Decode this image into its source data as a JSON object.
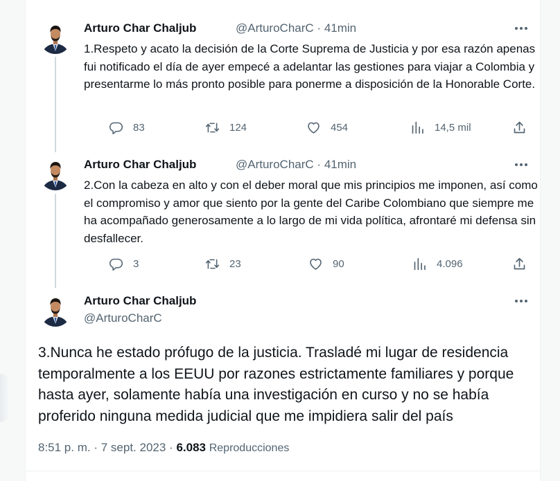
{
  "tweets": [
    {
      "name": "Arturo Char Chaljub",
      "handle": "@ArturoCharC",
      "time": "41min",
      "text": "1.Respeto  y acato la decisión de la Corte Suprema de Justicia y por esa razón apenas fui notificado el día de ayer empecé a adelantar las gestiones para viajar a Colombia y presentarme lo más pronto posible para ponerme a disposición de la Honorable Corte.",
      "replies": "83",
      "retweets": "124",
      "likes": "454",
      "views": "14,5 mil"
    },
    {
      "name": "Arturo Char Chaljub",
      "handle": "@ArturoCharC",
      "time": "41min",
      "text": "2.Con la cabeza en alto y con el deber moral que mis principios me imponen, así como el compromiso y amor que siento por la gente del Caribe Colombiano que siempre me ha acompañado generosamente a lo largo de mi vida política, afrontaré mi defensa sin desfallecer.",
      "replies": "3",
      "retweets": "23",
      "likes": "90",
      "views": "4.096"
    }
  ],
  "main_tweet": {
    "name": "Arturo Char Chaljub",
    "handle": "@ArturoCharC",
    "text": "3.Nunca he estado prófugo de la justicia. Trasladé mi lugar de residencia temporalmente a los EEUU por razones estrictamente familiares y porque hasta ayer, solamente había una investigación en curso y no se había proferido ninguna medida judicial que me impidiera salir del país",
    "time": "8:51 p. m.",
    "date": "7 sept. 2023",
    "separator": "·",
    "views_count": "6.083",
    "views_label": "Reproducciones"
  },
  "icons": {
    "avatar": "avatar-photo",
    "more": "more-dots-icon",
    "reply": "reply-icon",
    "retweet": "retweet-icon",
    "like": "heart-icon",
    "views": "views-chart-icon",
    "share": "share-icon"
  },
  "colors": {
    "text": "#0f1419",
    "muted": "#536471",
    "thread_line": "#cfd9de",
    "background": "#ffffff"
  }
}
